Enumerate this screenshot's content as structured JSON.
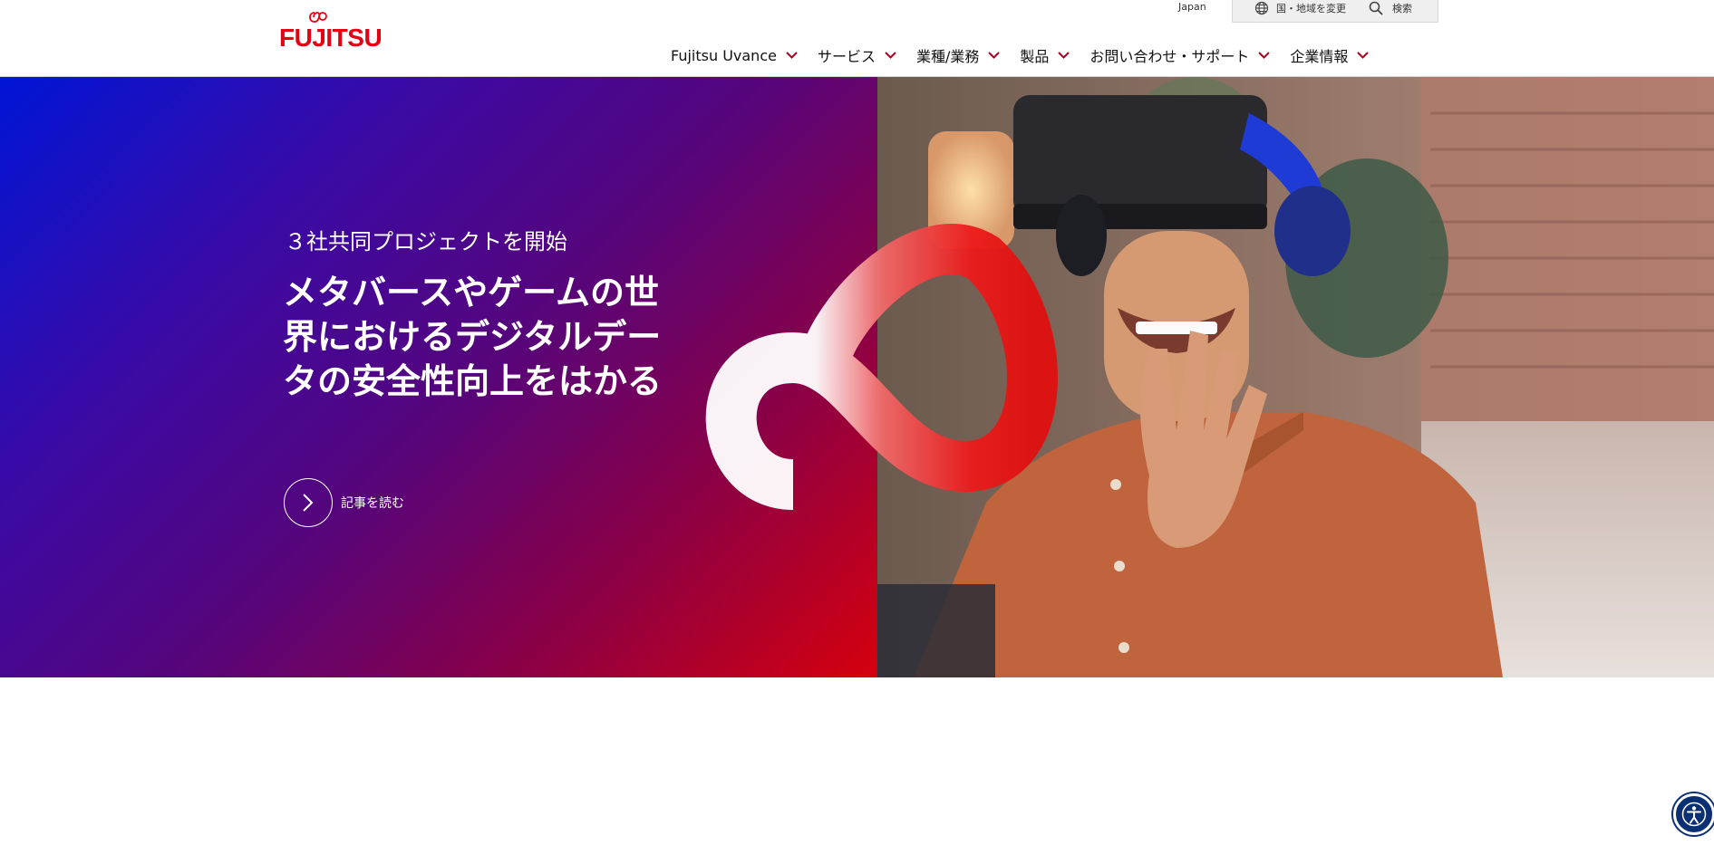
{
  "brand": {
    "logo_text": "FUJITSU",
    "color": "#e60012"
  },
  "utility": {
    "region": "Japan",
    "language_label": "国・地域を変更",
    "search_label": "検索"
  },
  "nav": {
    "items": [
      {
        "label": "Fujitsu Uvance"
      },
      {
        "label": "サービス"
      },
      {
        "label": "業種/業務"
      },
      {
        "label": "製品"
      },
      {
        "label": "お問い合わせ・サポート"
      },
      {
        "label": "企業情報"
      }
    ],
    "chevron_color": "#b1001c"
  },
  "hero": {
    "kicker": "３社共同プロジェクトを開始",
    "headline": "メタバースやゲームの世界におけるデジタルデータの安全性向上をはかる",
    "cta_label": "記事を読む"
  },
  "icons": {
    "globe": "globe-icon",
    "search": "search-icon",
    "chevron": "chevron-down-icon",
    "cta_arrow": "chevron-right-icon",
    "accessibility": "accessibility-icon"
  }
}
